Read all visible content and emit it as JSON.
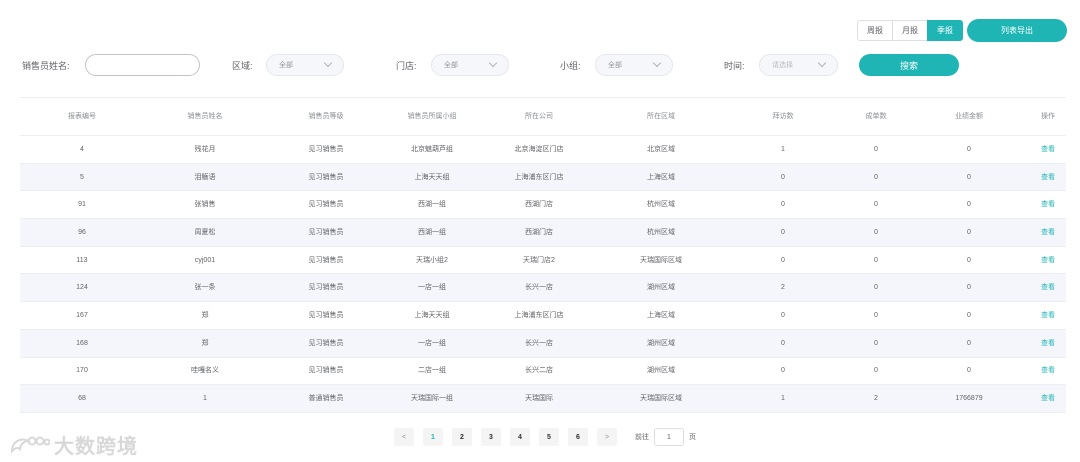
{
  "period": {
    "options": [
      "周报",
      "月报",
      "季报"
    ],
    "active_index": 2
  },
  "export_label": "列表导出",
  "filters": {
    "name_label": "销售员姓名:",
    "name_value": "",
    "region_label": "区域:",
    "region_value": "全部",
    "store_label": "门店:",
    "store_value": "全部",
    "group_label": "小组:",
    "group_value": "全部",
    "time_label": "时间:",
    "time_placeholder": "请选择",
    "search_label": "搜索"
  },
  "table": {
    "headers": [
      "报表编号",
      "销售员姓名",
      "销售员等级",
      "销售员所属小组",
      "所在公司",
      "所在区域",
      "拜访数",
      "成单数",
      "业绩金额",
      "操作"
    ],
    "rows": [
      [
        "4",
        "残花月",
        "见习销售员",
        "北京魅葫芦组",
        "北京海淀区门店",
        "北京区域",
        "1",
        "0",
        "0",
        "查看"
      ],
      [
        "5",
        "泪觞语",
        "见习销售员",
        "上海天天组",
        "上海浦东区门店",
        "上海区域",
        "0",
        "0",
        "0",
        "查看"
      ],
      [
        "91",
        "张销售",
        "见习销售员",
        "西湖一组",
        "西湖门店",
        "杭州区域",
        "0",
        "0",
        "0",
        "查看"
      ],
      [
        "96",
        "周夏松",
        "见习销售员",
        "西湖一组",
        "西湖门店",
        "杭州区域",
        "0",
        "0",
        "0",
        "查看"
      ],
      [
        "113",
        "cyj001",
        "见习销售员",
        "天瑞小组2",
        "天瑞门店2",
        "天瑞国际区域",
        "0",
        "0",
        "0",
        "查看"
      ],
      [
        "124",
        "张一条",
        "见习销售员",
        "一店一组",
        "长兴一店",
        "湖州区域",
        "2",
        "0",
        "0",
        "查看"
      ],
      [
        "167",
        "郑",
        "见习销售员",
        "上海天天组",
        "上海浦东区门店",
        "上海区域",
        "0",
        "0",
        "0",
        "查看"
      ],
      [
        "168",
        "郑",
        "见习销售员",
        "一店一组",
        "长兴一店",
        "湖州区域",
        "0",
        "0",
        "0",
        "查看"
      ],
      [
        "170",
        "哇嘎名义",
        "见习销售员",
        "二店一组",
        "长兴二店",
        "湖州区域",
        "0",
        "0",
        "0",
        "查看"
      ],
      [
        "68",
        "1",
        "普通销售员",
        "天瑞国际一组",
        "天瑞国际",
        "天瑞国际区域",
        "1",
        "2",
        "1766879",
        "查看"
      ]
    ]
  },
  "pagination": {
    "prev": "<",
    "pages": [
      "1",
      "2",
      "3",
      "4",
      "5",
      "6"
    ],
    "active_page": "1",
    "next": ">",
    "goto_label": "前往",
    "goto_value": "1",
    "page_suffix": "页"
  },
  "watermark": {
    "text": "大数跨境",
    "icon": "dolphin-logo-icon"
  }
}
